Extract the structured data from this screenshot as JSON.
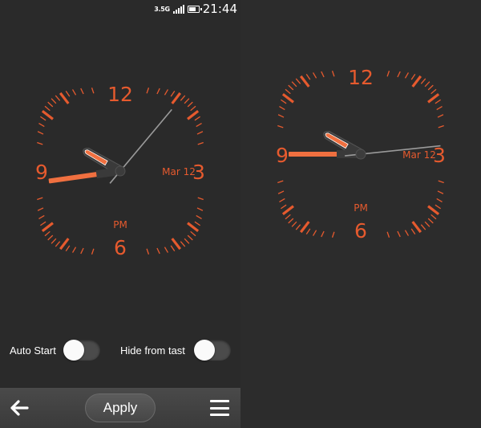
{
  "status_bar": {
    "network": "3.5G",
    "time": "21:44",
    "signal_bars": 5,
    "battery_level": 0.6
  },
  "clock_face": {
    "numerals": [
      "12",
      "3",
      "6",
      "9"
    ],
    "date": "Mar 12",
    "meridiem": "PM",
    "accent_color": "#e65a2e",
    "hand_color": "#f07040"
  },
  "preview_left": {
    "hour_deg": -60,
    "minute_deg": 262,
    "second_deg": 40
  },
  "preview_right": {
    "hour_deg": -60,
    "minute_deg": 270,
    "second_deg": 84
  },
  "settings": {
    "auto_start": {
      "label": "Auto Start",
      "enabled": false
    },
    "hide_from_task": {
      "label": "Hide from tast",
      "enabled": false
    }
  },
  "toolbar": {
    "back_icon": "back-arrow-icon",
    "apply_label": "Apply",
    "menu_icon": "menu-icon"
  }
}
